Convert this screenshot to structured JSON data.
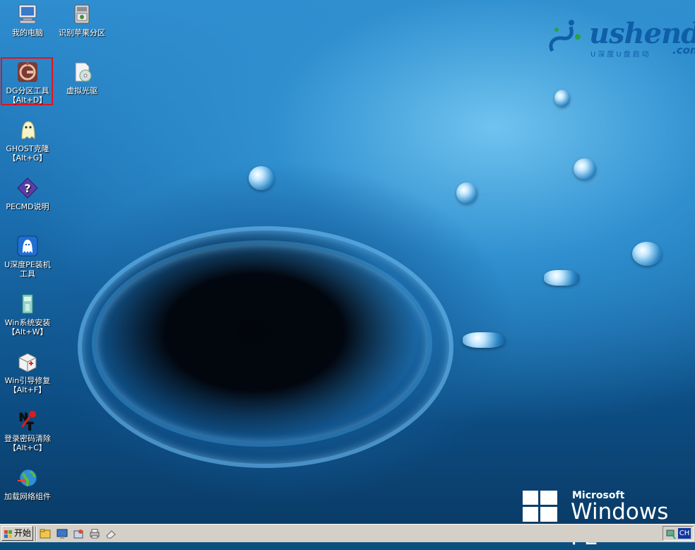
{
  "desktop": {
    "icons": [
      {
        "label": "我的电脑",
        "label2": ""
      },
      {
        "label": "识别苹果分区",
        "label2": ""
      },
      {
        "label": "DG分区工具",
        "label2": "【Alt+D】"
      },
      {
        "label": "虚拟光驱",
        "label2": ""
      },
      {
        "label": "GHOST克隆",
        "label2": "【Alt+G】"
      },
      {
        "label": "PECMD说明",
        "label2": ""
      },
      {
        "label": "U深度PE装机",
        "label2": "工具"
      },
      {
        "label": "Win系统安装",
        "label2": "【Alt+W】"
      },
      {
        "label": "Win引导修复",
        "label2": "【Alt+F】"
      },
      {
        "label": "登录密码清除",
        "label2": "【Alt+C】"
      },
      {
        "label": "加载网络组件",
        "label2": ""
      }
    ]
  },
  "logo": {
    "word": "ushendu",
    "sub": "U深度U盘启动",
    "com": ".com"
  },
  "winpe": {
    "brand": "Microsoft",
    "product": "Windows PE"
  },
  "taskbar": {
    "start_label": "开始",
    "lang": "CH"
  },
  "colors": {
    "selection": "#e0141e",
    "taskbar": "#d4d0c8"
  }
}
